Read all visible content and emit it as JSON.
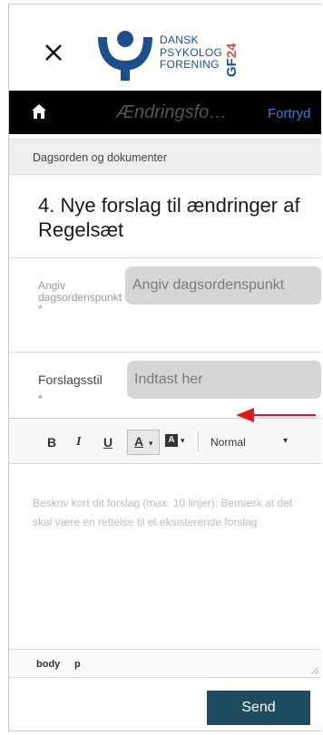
{
  "header": {
    "logo_lines": [
      "DANSK",
      "PSYKOLOG",
      "FORENING"
    ],
    "badge": "GF24",
    "colors": {
      "brand_blue": "#1f4e8c",
      "badge_red": "#d9534f"
    }
  },
  "nav": {
    "title": "Ændringsfo…",
    "cancel_label": "Fortryd"
  },
  "section": {
    "label": "Dagsorden og dokumenter"
  },
  "agenda": {
    "title": "4. Nye forslag til ændringer af Regelsæt"
  },
  "form": {
    "agenda_point": {
      "label": "Angiv dagsordenspunkt",
      "required_mark": "*",
      "placeholder": "Angiv dagsordenspunkt"
    },
    "proposer": {
      "label": "Forslagsstil",
      "required_mark": "*",
      "placeholder": "Indtast her"
    }
  },
  "editor": {
    "bold": "B",
    "italic": "I",
    "underline": "U",
    "font_color": "A",
    "bg_color": "A",
    "format": "Normal",
    "placeholder": "Beskriv kort dit forslag (max. 10 linjer). Bemærk at det skal være en rettelse til et eksisterende forslag",
    "path": [
      "body",
      "p"
    ]
  },
  "footer": {
    "send_label": "Send",
    "send_color": "#1e4b5e"
  }
}
